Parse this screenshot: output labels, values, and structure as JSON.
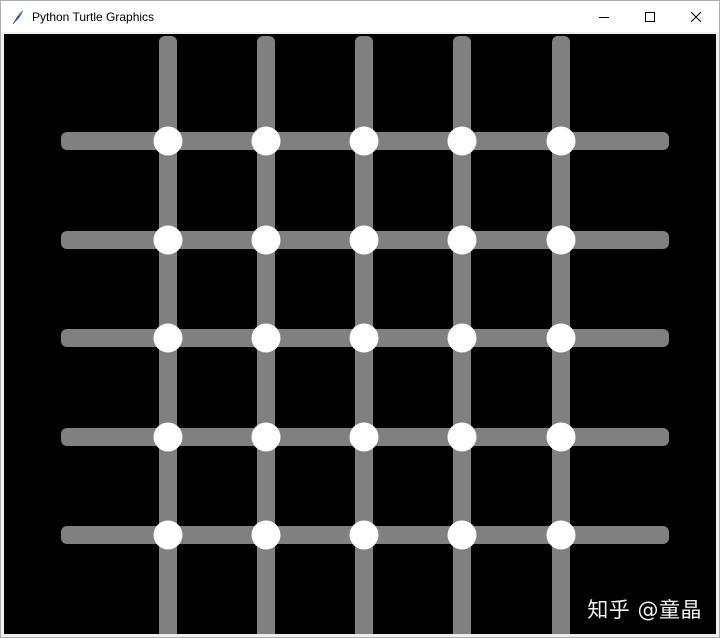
{
  "window": {
    "title": "Python Turtle Graphics",
    "icons": {
      "app": "feather-icon",
      "minimize": "minimize-icon",
      "maximize": "maximize-icon",
      "close": "close-icon"
    }
  },
  "canvas": {
    "background": "#000000",
    "line_color": "#808080",
    "dot_color": "#ffffff",
    "rows": 5,
    "cols": 5
  },
  "watermark": {
    "text": "知乎 @童晶"
  }
}
